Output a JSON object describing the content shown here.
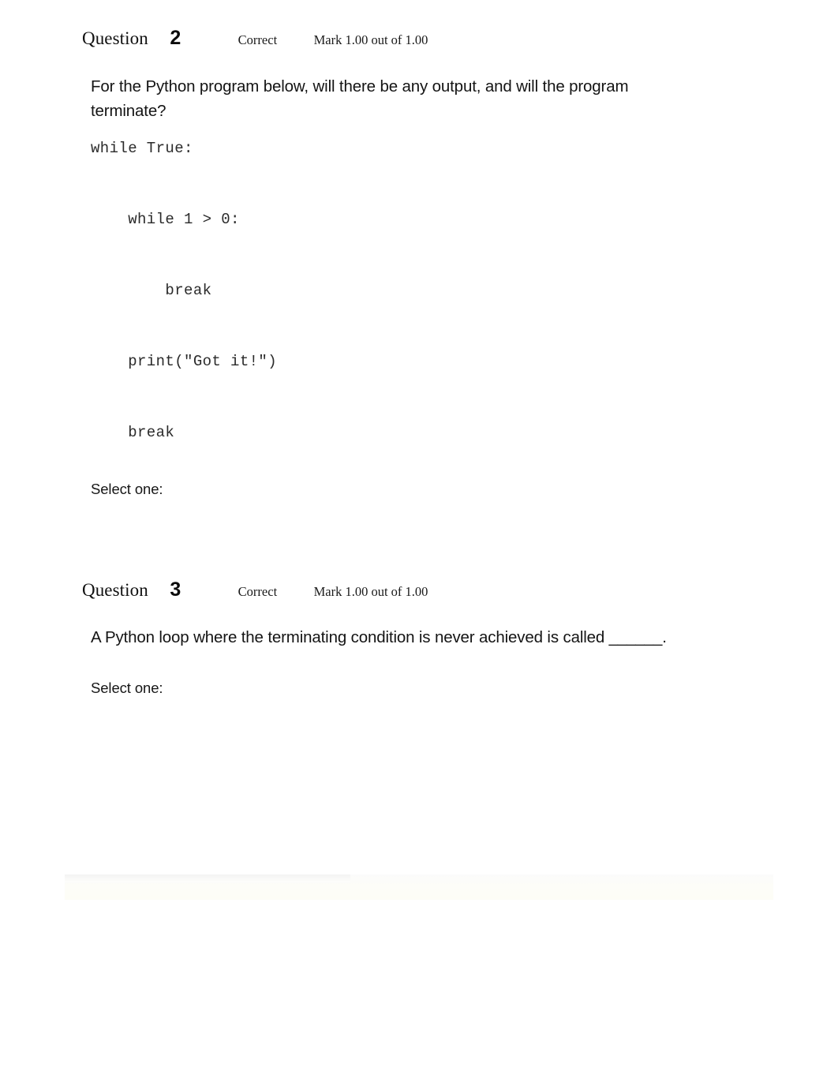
{
  "page": {
    "background_color": "#ffffff",
    "text_color": "#141414"
  },
  "questions": [
    {
      "label": "Question",
      "number": "2",
      "state": "Correct",
      "mark": "Mark 1.00 out of 1.00",
      "prompt": "For the Python program below, will there be any output, and will the program terminate?",
      "code": "while True:\n\n    while 1 > 0:\n\n        break\n\n    print(\"Got it!\")\n\n    break",
      "select_label": "Select one:",
      "options": []
    },
    {
      "label": "Question",
      "number": "3",
      "state": "Correct",
      "mark": "Mark 1.00 out of 1.00",
      "prompt": "A Python loop where the terminating condition is never achieved is called ______.",
      "code": "",
      "select_label": "Select one:",
      "options": []
    }
  ],
  "footer_band": {
    "color": "#fdfdf6"
  }
}
